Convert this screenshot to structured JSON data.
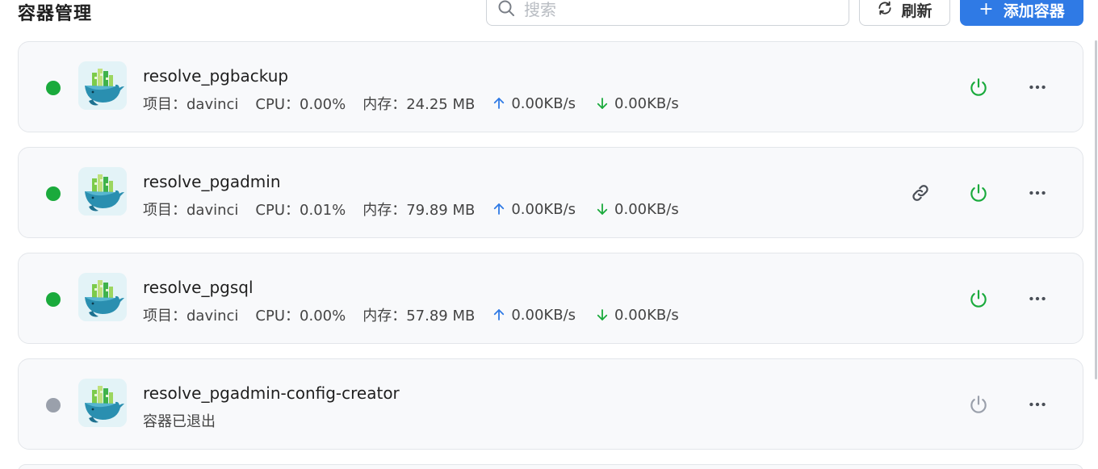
{
  "header": {
    "title": "容器管理",
    "search_placeholder": "搜索",
    "refresh_label": "刷新",
    "add_label": "添加容器"
  },
  "colors": {
    "accent": "#2f7ae5",
    "running": "#1aaa3c",
    "stopped": "#9aa0ab",
    "upload_arrow": "#2f7ae5",
    "download_arrow": "#1aaa3c"
  },
  "containers": [
    {
      "name": "resolve_pgbackup",
      "state": "running",
      "project": "项目：davinci",
      "cpu": "CPU：0.00%",
      "memory": "内存：24.25 MB",
      "upload": "0.00KB/s",
      "download": "0.00KB/s",
      "has_link": false
    },
    {
      "name": "resolve_pgadmin",
      "state": "running",
      "project": "项目：davinci",
      "cpu": "CPU：0.01%",
      "memory": "内存：79.89 MB",
      "upload": "0.00KB/s",
      "download": "0.00KB/s",
      "has_link": true
    },
    {
      "name": "resolve_pgsql",
      "state": "running",
      "project": "项目：davinci",
      "cpu": "CPU：0.00%",
      "memory": "内存：57.89 MB",
      "upload": "0.00KB/s",
      "download": "0.00KB/s",
      "has_link": false
    },
    {
      "name": "resolve_pgadmin-config-creator",
      "state": "stopped",
      "status_text": "容器已退出",
      "has_link": false
    }
  ],
  "icons": {
    "search": "search-icon",
    "refresh": "refresh-icon",
    "add": "plus-icon",
    "status": "status-dot",
    "container": "docker-whale-icon",
    "upload": "arrow-up-icon",
    "download": "arrow-down-icon",
    "link": "link-icon",
    "power": "power-icon",
    "more": "more-icon"
  }
}
